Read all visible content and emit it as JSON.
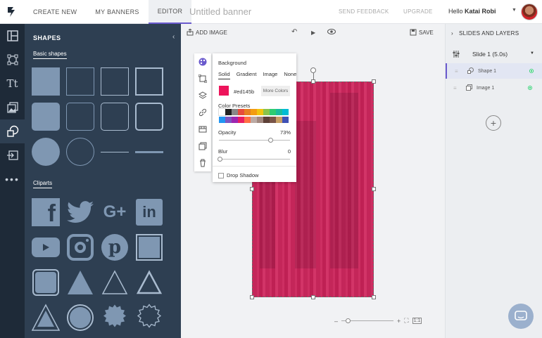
{
  "topbar": {
    "tabs": [
      "CREATE NEW",
      "MY BANNERS",
      "EDITOR"
    ],
    "title": "Untitled banner",
    "feedback": "SEND FEEDBACK",
    "upgrade": "UPGRADE",
    "hello": "Hello",
    "user": "Katai Robi"
  },
  "panel": {
    "title": "SHAPES",
    "basic_label": "Basic shapes",
    "cliparts_label": "Cliparts"
  },
  "toolbar": {
    "add_image": "ADD IMAGE",
    "save": "SAVE"
  },
  "background": {
    "title": "Background",
    "types": [
      "Solid",
      "Gradient",
      "Image",
      "None"
    ],
    "hex": "#ed145b",
    "more_colors": "More Colors",
    "presets_label": "Color Presets",
    "opacity_label": "Opacity",
    "opacity_value": "73%",
    "opacity": 0.73,
    "blur_label": "Blur",
    "blur_value": "0",
    "drop_shadow": "Drop Shadow",
    "color": "#ed145b",
    "palette": [
      "#ffffff",
      "#222222",
      "#888888",
      "#e74c3c",
      "#e67e22",
      "#f39c12",
      "#f1c40f",
      "#8bc34a",
      "#2ecc71",
      "#1abc9c",
      "#00bcd4",
      "#2196f3",
      "#7e57c2",
      "#9c27b0",
      "#e91e63",
      "#ff7043",
      "#bcaaa4",
      "#a1887f",
      "#5d4037",
      "#795548",
      "#c8a165",
      "#3f51b5"
    ]
  },
  "layers": {
    "header": "SLIDES AND LAYERS",
    "slide": "Slide 1 (5.0s)",
    "items": [
      {
        "name": "Shape 1"
      },
      {
        "name": "Image 1"
      }
    ]
  },
  "zoom": {
    "minus": "–",
    "plus": "+",
    "fit": "1:1"
  },
  "colors": {
    "accent": "#6a5acd",
    "dark": "#1e2a38",
    "panel": "#2e3f52"
  }
}
